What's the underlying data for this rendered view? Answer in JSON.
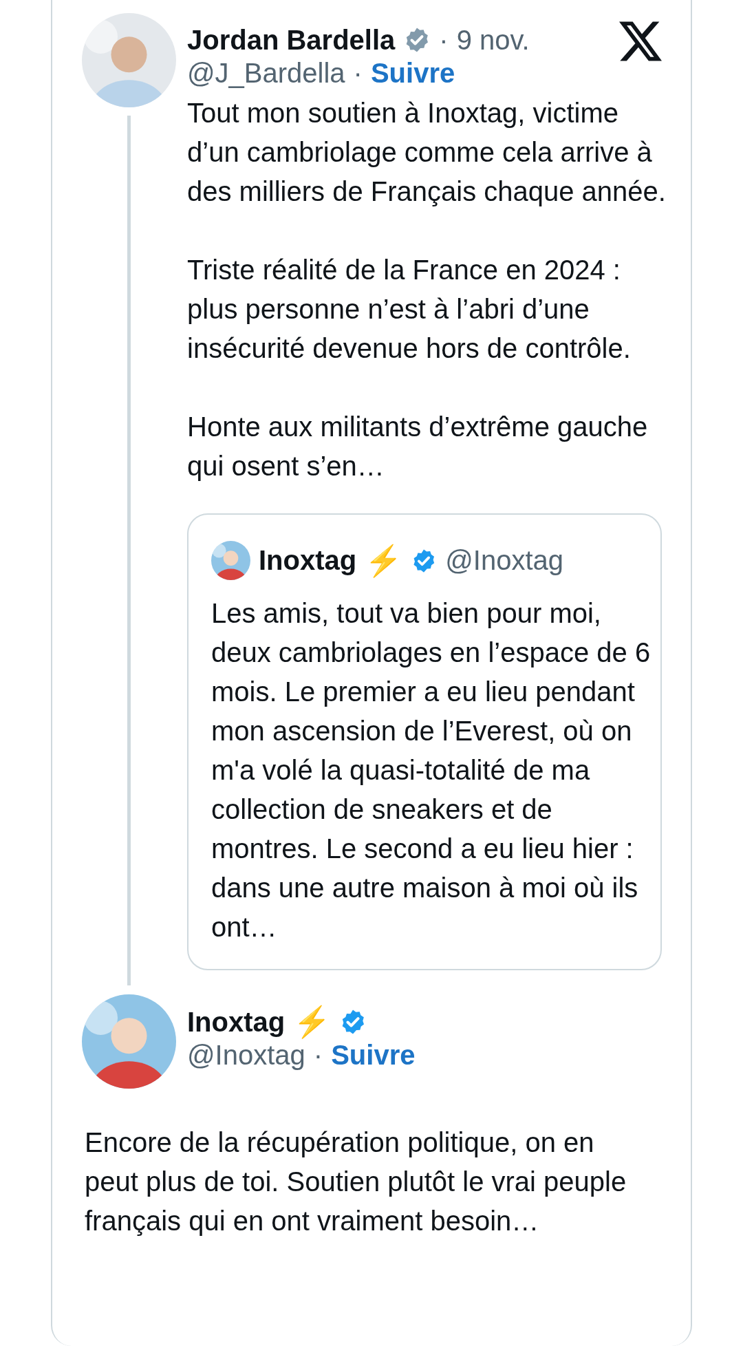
{
  "tweet": {
    "author": {
      "name": "Jordan Bardella",
      "badge": {
        "color": "#829aab"
      },
      "separator": "·",
      "date": "9 nov.",
      "handle": "@J_Bardella",
      "follow": "Suivre"
    },
    "paragraphs": [
      "Tout mon soutien à Inoxtag, victime d’un cambriolage comme cela arrive à des milliers de Français chaque année.",
      "Triste réalité de la France en 2024 : plus personne n’est à l’abri d’une insécurité devenue hors de contrôle.",
      "Honte aux militants d’extrême gauche qui osent s’en…"
    ],
    "quote": {
      "author": {
        "name": "Inoxtag",
        "emoji": "⚡",
        "badge": {
          "color": "#1d9bf0"
        },
        "handle": "@Inoxtag"
      },
      "text": "Les amis, tout va bien pour moi, deux cambriolages en l’espace de 6 mois. Le premier a eu lieu pendant mon ascension de l’Everest, où on m'a volé la quasi-totalité de ma collection de sneakers et de montres. Le second a eu lieu hier : dans une autre maison à moi où ils ont…"
    }
  },
  "reply": {
    "author": {
      "name": "Inoxtag",
      "emoji": "⚡",
      "badge": {
        "color": "#1d9bf0"
      },
      "separator": "·",
      "handle": "@Inoxtag",
      "follow": "Suivre"
    },
    "text": "Encore de la récupération politique, on en peut plus de toi. Soutien plutôt le vrai peuple français qui en ont vraiment besoin…"
  }
}
